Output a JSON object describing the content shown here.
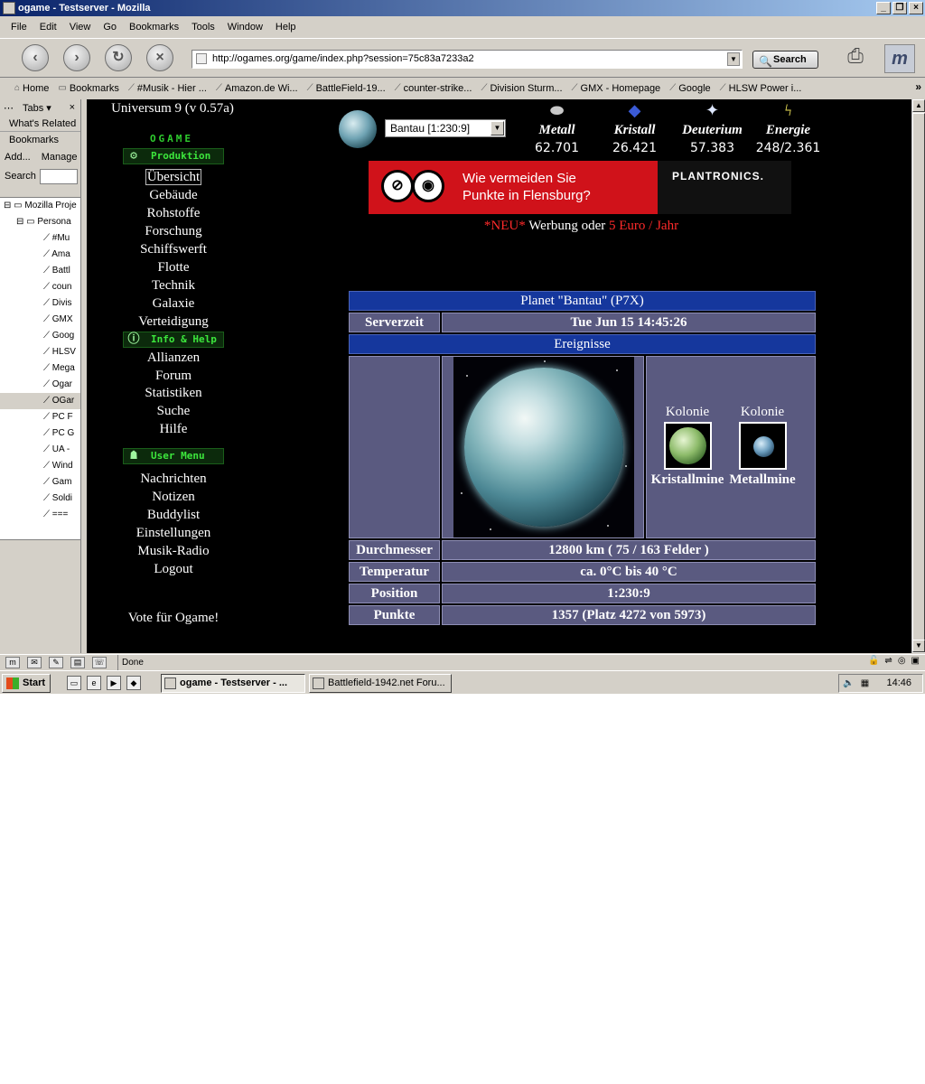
{
  "window": {
    "title": "ogame - Testserver - Mozilla",
    "buttons": [
      "_",
      "❐",
      "×"
    ]
  },
  "menubar": [
    "File",
    "Edit",
    "View",
    "Go",
    "Bookmarks",
    "Tools",
    "Window",
    "Help"
  ],
  "navbar": {
    "url": "http://ogames.org/game/index.php?session=75c83a7233a2",
    "search_label": "Search"
  },
  "bookmarks": [
    "Home",
    "Bookmarks",
    "#Musik - Hier ...",
    "Amazon.de Wi...",
    "BattleField-19...",
    "counter-strike...",
    "Division Sturm...",
    "GMX - Homepage",
    "Google",
    "HLSW  Power i..."
  ],
  "sidebar": {
    "tabs_label": "Tabs",
    "close": "×",
    "whats_related": "What's Related",
    "bookmarks_tab": "Bookmarks",
    "add": "Add...",
    "manage": "Manage",
    "search_label": "Search",
    "tree": [
      "Mozilla Proje",
      "Persona",
      "#Mu",
      "Ama",
      "Battl",
      "coun",
      "Divis",
      "GMX",
      "Goog",
      "HLSV",
      "Mega",
      "Ogar",
      "OGar",
      "PC F",
      "PC G",
      "UA -",
      "Wind",
      "Gam",
      "Soldi",
      "==="
    ]
  },
  "game": {
    "universe": "Universum 9 (v 0.57a)",
    "logo": "OGAME",
    "headers": {
      "produktion": "Produktion",
      "info": "Info & Help",
      "user": "User Menu"
    },
    "menu_produktion": [
      "Übersicht",
      "Gebäude",
      "Rohstoffe",
      "Forschung",
      "Schiffswerft",
      "Flotte",
      "Technik",
      "Galaxie",
      "Verteidigung"
    ],
    "menu_info": [
      "Allianzen",
      "Forum",
      "Statistiken",
      "Suche",
      "Hilfe"
    ],
    "menu_user": [
      "Nachrichten",
      "Notizen",
      "Buddylist",
      "Einstellungen",
      "Musik-Radio",
      "Logout"
    ],
    "vote": "Vote für Ogame!",
    "planet_select": "Bantau [1:230:9]",
    "resources": [
      {
        "name": "Metall",
        "value": "62.701",
        "icon": "metal-icon"
      },
      {
        "name": "Kristall",
        "value": "26.421",
        "icon": "crystal-icon"
      },
      {
        "name": "Deuterium",
        "value": "57.383",
        "icon": "deuterium-icon"
      },
      {
        "name": "Energie",
        "value": "248/2.361",
        "icon": "energy-icon"
      }
    ],
    "ad": {
      "line1": "Wie vermeiden Sie",
      "line2": "Punkte in Flensburg?",
      "brand": "PLANTRONICS."
    },
    "promo": {
      "neu": "*NEU*",
      "middle": " Werbung oder ",
      "price": "5 Euro / Jahr"
    },
    "table": {
      "planet_title": "Planet \"Bantau\" (P7X)",
      "serverzeit_label": "Serverzeit",
      "serverzeit_value": "Tue Jun 15 14:45:26",
      "events_title": "Ereignisse",
      "colonies": [
        {
          "title": "Kolonie",
          "label": "Kristallmine"
        },
        {
          "title": "Kolonie",
          "label": "Metallmine"
        }
      ],
      "rows": [
        {
          "label": "Durchmesser",
          "value": "12800 km ( 75 / 163 Felder )"
        },
        {
          "label": "Temperatur",
          "value": "ca. 0°C bis 40 °C"
        },
        {
          "label": "Position",
          "value": "1:230:9"
        },
        {
          "label": "Punkte",
          "value": "1357 (Platz 4272 von 5973)"
        }
      ]
    }
  },
  "statusbar": {
    "text": "Done"
  },
  "taskbar": {
    "start": "Start",
    "tasks": [
      "ogame - Testserver - ...",
      "Battlefield-1942.net Foru..."
    ],
    "clock": "14:46"
  }
}
